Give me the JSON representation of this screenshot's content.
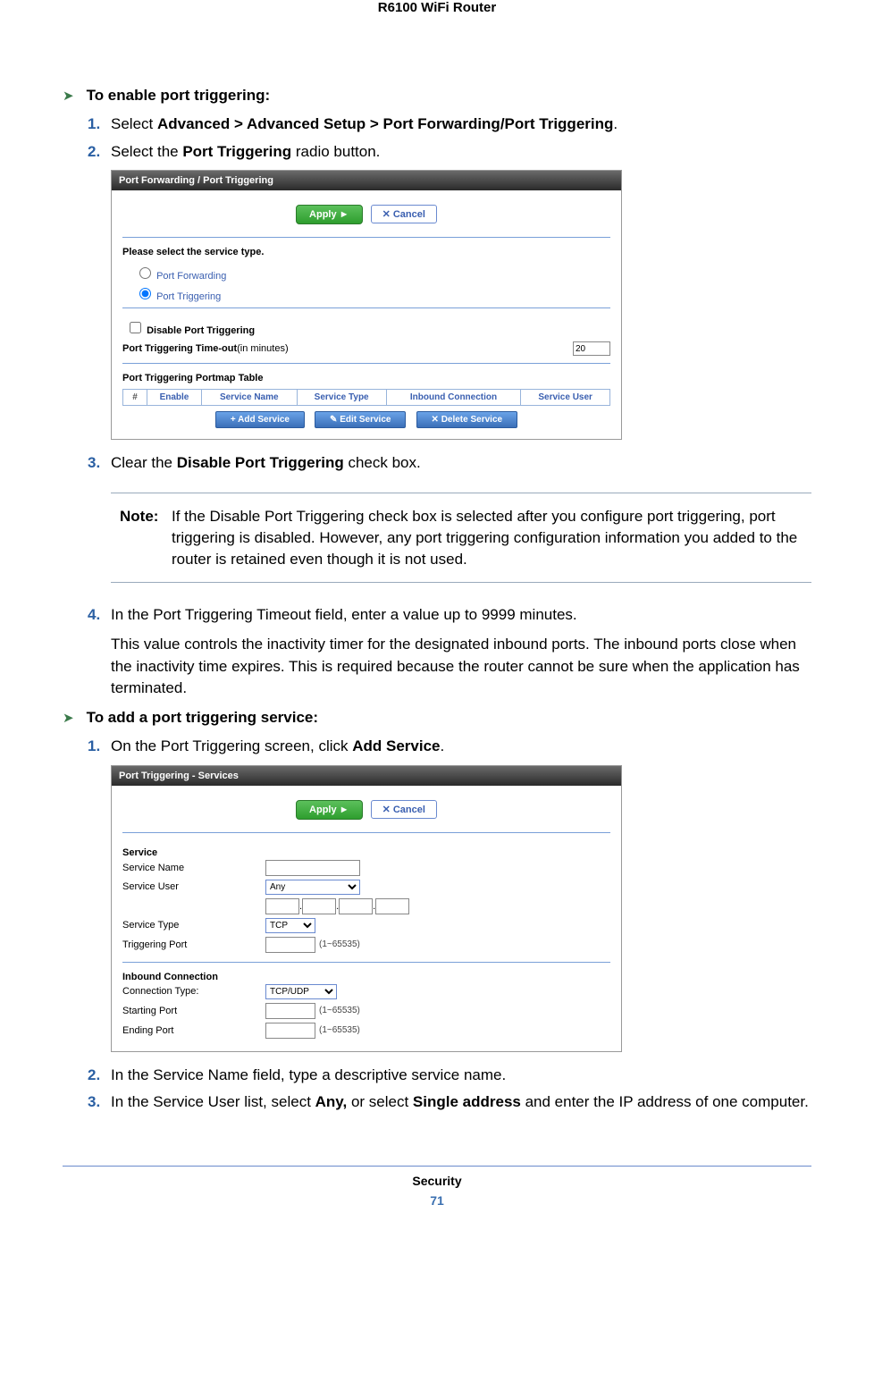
{
  "doc": {
    "header": "R6100 WiFi Router",
    "footer_chapter": "Security",
    "footer_page": "71"
  },
  "sectionA": {
    "title": "To enable port triggering:",
    "step1_num": "1.",
    "step1_a": "Select ",
    "step1_b": "Advanced > Advanced Setup > Port Forwarding/Port Triggering",
    "step1_c": ".",
    "step2_num": "2.",
    "step2_a": "Select the ",
    "step2_b": "Port Triggering",
    "step2_c": " radio button.",
    "step3_num": "3.",
    "step3_a": "Clear the ",
    "step3_b": "Disable Port Triggering",
    "step3_c": " check box.",
    "step4_num": "4.",
    "step4_text": "In the Port Triggering Timeout field, enter a value up to 9999 minutes.",
    "step4_para": "This value controls the inactivity timer for the designated inbound ports. The inbound ports close when the inactivity time expires. This is required because the router cannot be sure when the application has terminated."
  },
  "note": {
    "label": "Note:",
    "text": "If the Disable Port Triggering check box is selected after you configure port triggering, port triggering is disabled. However, any port triggering configuration information you added to the router is retained even though it is not used."
  },
  "sectionB": {
    "title": "To add a port triggering service:",
    "step1_num": "1.",
    "step1_a": "On the Port Triggering screen, click ",
    "step1_b": "Add Service",
    "step1_c": ".",
    "step2_num": "2.",
    "step2_text": "In the Service Name field, type a descriptive service name.",
    "step3_num": "3.",
    "step3_a": "In the Service User list, select ",
    "step3_b": "Any,",
    "step3_c": " or select ",
    "step3_d": "Single address",
    "step3_e": " and enter the IP address of one computer."
  },
  "ss1": {
    "title": "Port Forwarding / Port Triggering",
    "apply": "Apply ►",
    "cancel": "✕ Cancel",
    "please_select": "Please select the service type.",
    "r1": "Port Forwarding",
    "r2": "Port Triggering",
    "chk": "Disable Port Triggering",
    "timeout_lbl": "Port Triggering Time-out",
    "timeout_unit": "(in minutes)",
    "timeout_val": "20",
    "table_title": "Port Triggering Portmap Table",
    "th_hash": "#",
    "th_enable": "Enable",
    "th_svc": "Service Name",
    "th_type": "Service Type",
    "th_inbound": "Inbound Connection",
    "th_user": "Service User",
    "btn_add": "+ Add Service",
    "btn_edit": "✎ Edit Service",
    "btn_del": "✕ Delete Service"
  },
  "ss2": {
    "title": "Port Triggering - Services",
    "apply": "Apply ►",
    "cancel": "✕ Cancel",
    "h_svc": "Service",
    "l_name": "Service Name",
    "l_user": "Service User",
    "sel_user": "Any",
    "l_type": "Service Type",
    "sel_type": "TCP",
    "l_trig": "Triggering Port",
    "hint_trig": "(1~65535)",
    "h_inbound": "Inbound Connection",
    "l_conn": "Connection Type:",
    "sel_conn": "TCP/UDP",
    "l_start": "Starting Port",
    "hint_start": "(1~65535)",
    "l_end": "Ending Port",
    "hint_end": "(1~65535)"
  }
}
